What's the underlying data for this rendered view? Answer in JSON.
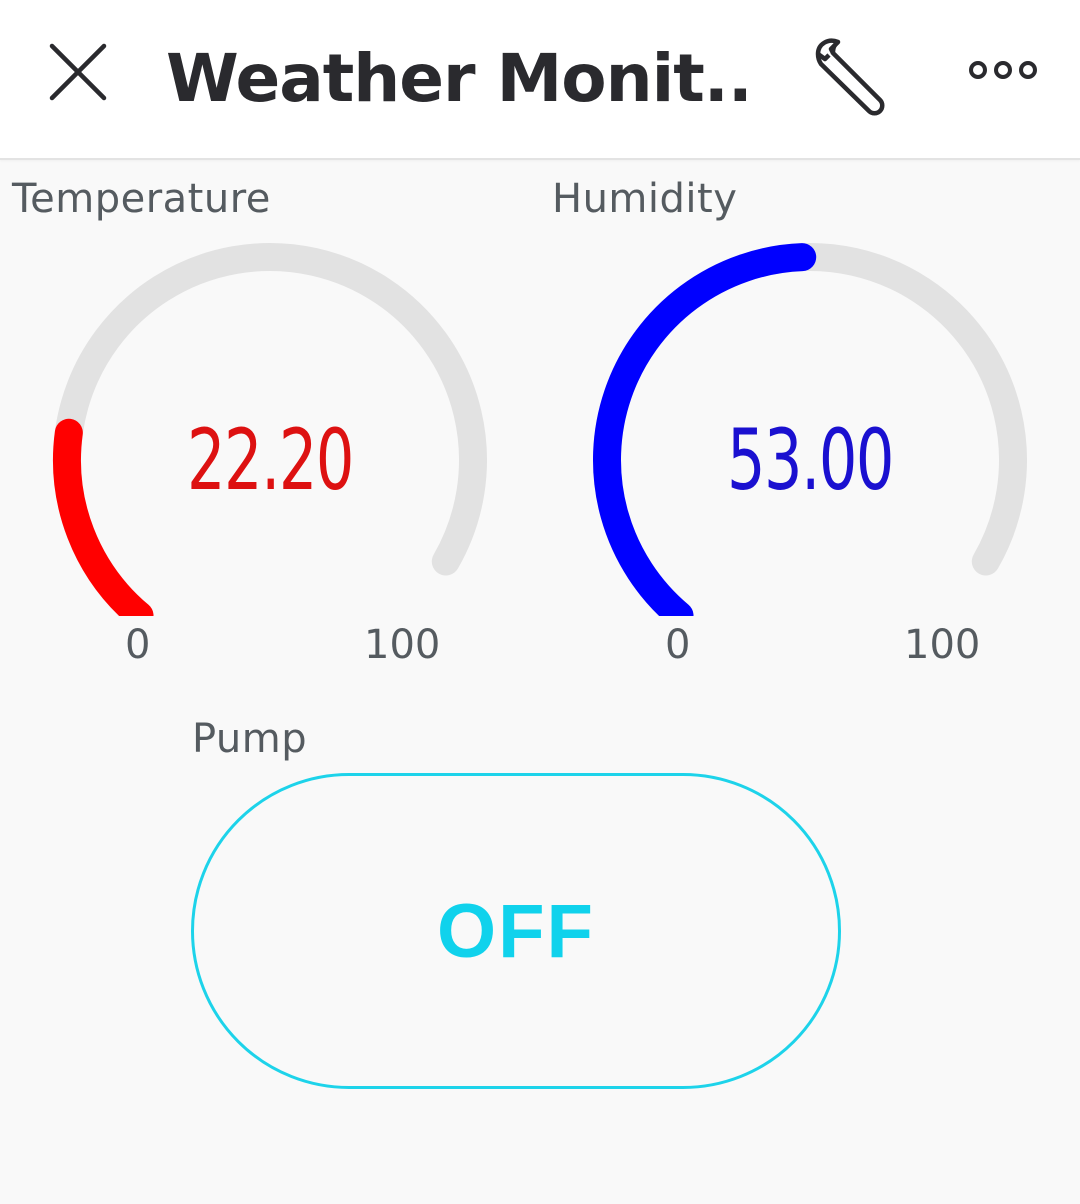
{
  "header": {
    "title": "Weather Monit...",
    "icons": {
      "close": "close-icon",
      "settings": "wrench-icon",
      "more": "more-icon"
    }
  },
  "gauges": [
    {
      "label": "Temperature",
      "value": 22.2,
      "value_text": "22.20",
      "min_label": "0",
      "max_label": "100",
      "min": 0,
      "max": 100,
      "color": "#ff0000",
      "text_color": "#dd1111"
    },
    {
      "label": "Humidity",
      "value": 53.0,
      "value_text": "53.00",
      "min_label": "0",
      "max_label": "100",
      "min": 0,
      "max": 100,
      "color": "#0000ff",
      "text_color": "#1a10d0"
    }
  ],
  "pump": {
    "label": "Pump",
    "state": "OFF",
    "color": "#10d2ec"
  },
  "colors": {
    "track": "#e2e2e2",
    "header_bg": "#ffffff",
    "body_bg": "#f9f9f9"
  }
}
